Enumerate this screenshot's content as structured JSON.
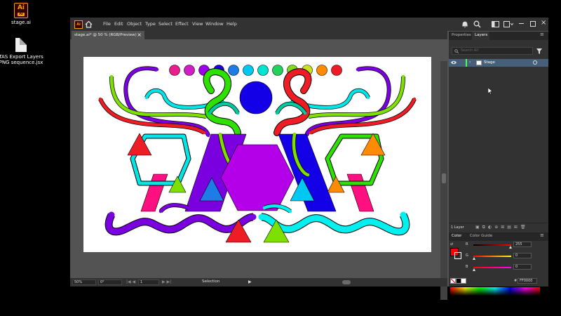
{
  "desktop": {
    "icons": [
      {
        "label": "stage.ai",
        "logo_text": "Ai",
        "logo_sub": "Ai"
      },
      {
        "label": "TAS Export Layers PNG sequence.jsx"
      }
    ]
  },
  "menubar": {
    "items": [
      "File",
      "Edit",
      "Object",
      "Type",
      "Select",
      "Effect",
      "View",
      "Window",
      "Help"
    ]
  },
  "document": {
    "tab_title": "stage.ai* @ 50 % (RGB/Preview)",
    "close_glyph": "×"
  },
  "statusbar": {
    "zoom": "50%",
    "rotation": "0°",
    "artboard_num": "1",
    "tool": "Selection"
  },
  "panel": {
    "tabs": [
      "Properties",
      "Layers"
    ],
    "active_tab": "Layers",
    "search_placeholder": "Search All",
    "layer_name": "Stage",
    "layer_count": "1 Layer",
    "color_tabs": [
      "Color",
      "Color Guide"
    ],
    "rgb": [
      {
        "label": "R",
        "value": "255",
        "level": 1.0
      },
      {
        "label": "G",
        "value": "0",
        "level": 0.0
      },
      {
        "label": "B",
        "value": "0",
        "level": 0.0
      }
    ],
    "hex_prefix": "#",
    "hex": "FF0000",
    "fill_color": "#ff0000"
  },
  "colors": {
    "app_bg": "#535353",
    "chrome": "#323232",
    "layer_highlight": "#46607a"
  },
  "artwork": {
    "dots": [
      "#e91e8c",
      "#d01ec6",
      "#9b00e8",
      "#1700d9",
      "#1e7ce6",
      "#00c8f0",
      "#00e5d0",
      "#22d25a",
      "#7ddc1e",
      "#c8e21e",
      "#ff8c00",
      "#ee1c24"
    ]
  }
}
